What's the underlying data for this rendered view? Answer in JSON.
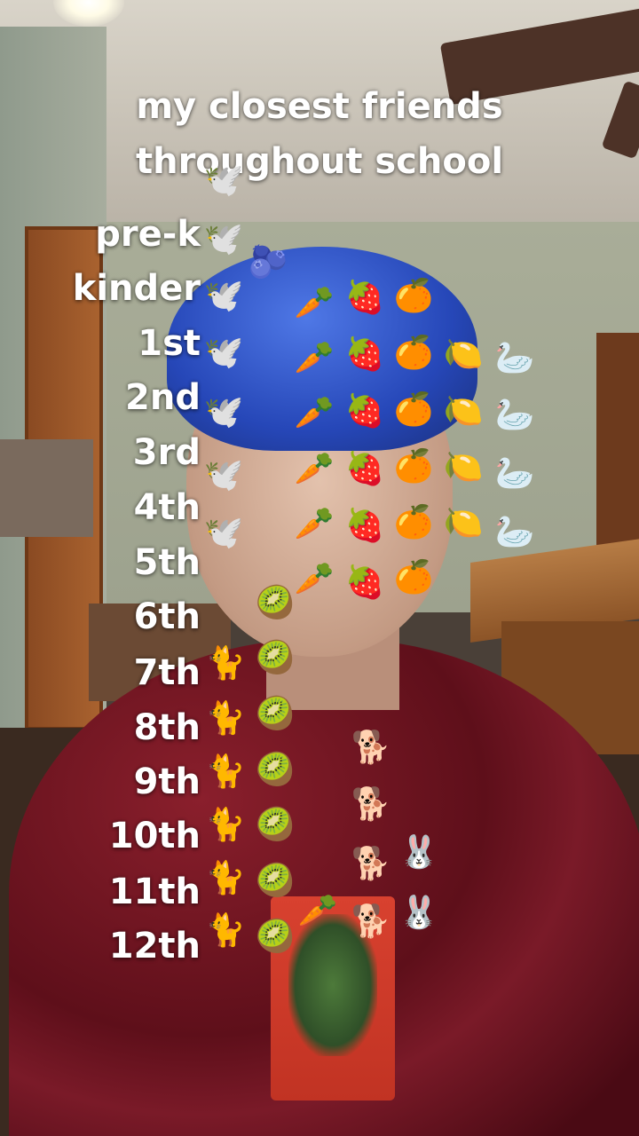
{
  "caption": {
    "line1": "my closest friends",
    "line2": "throughout school"
  },
  "grades": [
    "pre-k",
    "kinder",
    "1st",
    "2nd",
    "3rd",
    "4th",
    "5th",
    "6th",
    "7th",
    "8th",
    "9th",
    "10th",
    "11th",
    "12th"
  ],
  "emojis": {
    "dove": "🕊️",
    "blueberries": "🫐",
    "carrot": "🥕",
    "strawberry": "🍓",
    "tangerine": "🍊",
    "lemon": "🍋",
    "swan": "🦢",
    "kiwi": "🥝",
    "cat": "🐈",
    "dog": "🐕",
    "rabbit": "🐰"
  }
}
